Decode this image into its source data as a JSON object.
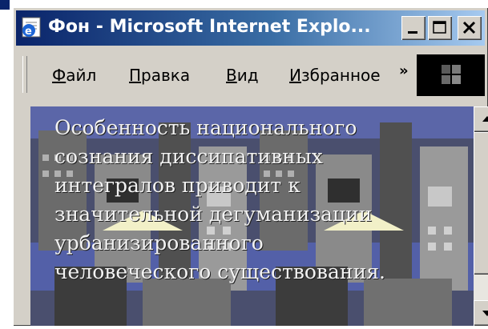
{
  "window": {
    "title": "Фон - Microsoft Internet Explo...",
    "controls": {
      "minimize_icon": "minimize-icon",
      "maximize_icon": "maximize-icon",
      "close_icon": "close-icon"
    }
  },
  "menubar": {
    "items": [
      {
        "label_first": "Ф",
        "label_rest": "айл"
      },
      {
        "label_first": "П",
        "label_rest": "равка"
      },
      {
        "label_first": "В",
        "label_rest": "ид"
      },
      {
        "label_first": "И",
        "label_rest": "збранное"
      }
    ],
    "chevron": "»"
  },
  "content": {
    "lines": [
      "Особенность национального",
      "сознания диссипативных",
      "интегралов приводит к",
      "значительной дегуманизации",
      "урбанизированного",
      "человеческого существования."
    ]
  },
  "colors": {
    "titlebar_start": "#0a246a",
    "titlebar_end": "#a6caf0",
    "chrome": "#d4d0c8"
  }
}
